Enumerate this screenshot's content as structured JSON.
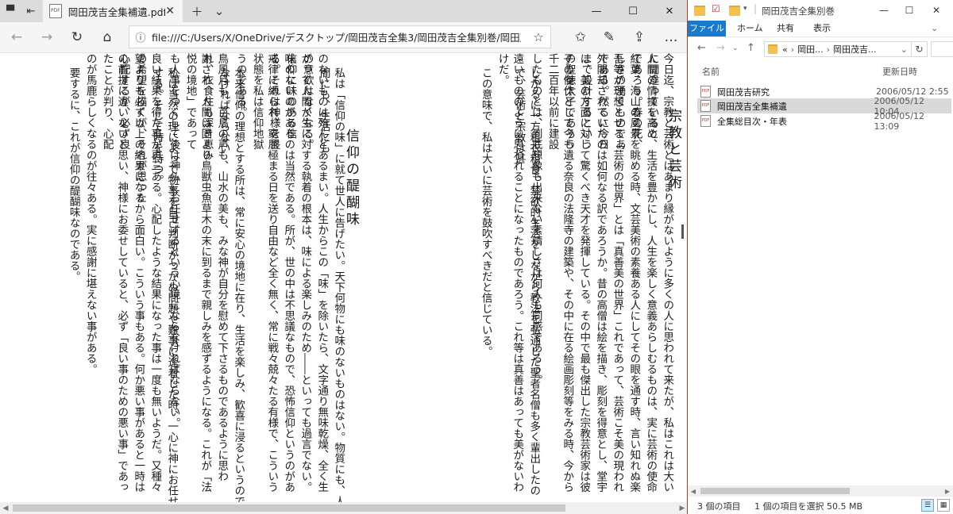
{
  "browser": {
    "tab_title": "岡田茂吉全集補遺.pdf",
    "tab_icon_text": "PDF",
    "url": "file:///C:/Users/X/OneDrive/デスクトップ/岡田茂吉全集3/岡田茂吉全集別巻/岡田茂吉全集補遺",
    "icons": [
      "tab-actions-icon",
      "back-tabs-icon",
      "close-icon",
      "new-tab-icon",
      "chevron-down-icon",
      "minimize-icon",
      "maximize-icon",
      "close-window-icon",
      "back-icon",
      "forward-icon",
      "refresh-icon",
      "home-icon",
      "info-icon",
      "favorite-star-icon",
      "favorites-icon",
      "pen-icon",
      "share-icon",
      "more-icon"
    ]
  },
  "document": {
    "essay1": {
      "title": "宗教と芸術",
      "columns": [
        "今日迄、宗教と芸術とはあまり縁がないように多くの人に思われて来たが、私はこれは大いに間違っていると",
        "人間の情操を高め、生活を豊かにし、人生を楽しく意義あらしむるものは、実に芸術の使命であろう。春の花、",
        "紅葉、海山の風景を眺める時、文芸美術の素養ある人にしてその眼を通す時、言い知れぬ楽しさの湧くものであ",
        "吾等が理想とせる「芸術の世界」とは「真善美の世界」これであって、芸術こそ美の現われである。然るに今日",
        "外閣却されていたのは如何なる訳であろうか。昔の高僧は絵を描き、彫刻を得意とし、堂宇まで設計するという",
        "に、美の方面に対して驚くべき天才を発揮している。その中で最も傑出した宗教芸術家は彼の聖徳太子であろう",
        "子の傑作として今も遺る奈良の法隆寺の建築や、その中に在る絵画彫刻等をみる時、今から千二百年以前に建設",
        "したものとは、到底想像も出来ない素晴しさは何人も同感であろう。",
        "しかるに一方粗衣粗食、禁欲的生活をしながら教法を弘通した聖者名僧も多く輩出したので、芸術と宗教は甚",
        "遠いもののように思われることになったものであろう。これ等は真善はあっても美がないわけだ。",
        "この意味で、私は大いに芸術を鼓吹すべきだと信じている。"
      ]
    },
    "essay2": {
      "title": "信仰の醍醐味",
      "columns": [
        "私は「信仰の味」に就て世人に告げたい。天下何物にも味のないものはない。物質にも、人間にも、生活にも",
        "のないものは殆んどあるまい。人生からこの「味」を除いたら、文字通り無味乾燥、全く生の意欲はなくなる。",
        "がって人間が生に対する執着の根本は、味による楽しみのため――といっても過言でない。信仰に味のある信",
        "味のないのがあるのは当然である。所が、世の中は不思議なもので、恐怖信仰というのがある。それは神様を畏",
        "戒律に縛られ、窮屈極まる日を送り自由など全く無く、常に戦々兢々たる有様で、こういう状態を私は信仰地獄",
        "うのである。",
        "本来信仰の理想とする所は、常に安心の境地に在り、生活を楽しみ、歓喜に浸るというのでなければならない",
        "鳥風月も、百鳥の声も、山水の美も、みな神が自分を慰めて下さるものであるように思われ、衣食住も深き恵み",
        "謝され、人間は固より鳥獣虫魚草木の末に到るまで親しみを感ずるようになる。これが「法悦の境地」であって",
        "も人事をつくして後は神仏にお任せするという心境にならなければならない。",
        "私は当然の理によって物事を自己判断がつかぬ問題や難事に逢着した時、一心に神にお任せする。そして時を待つ。",
        "良い結果を得た事が再三ある。心配したような結果になった事は一度も無いようだ。又種々の希望を描くが、それが思った",
        "望よりも必ず以上の結果になるから面白い。こういう事もある。何か悪い事があると一時は心配するが、必ず良",
        "の前提に違いないと思い、神様にお委せしていると、必ず「良い事のための悪い事」であったことが判り、心配",
        "のが馬鹿らしくなるのが往々ある。実に感謝に堪えない事がある。",
        "要するに、これが信仰の醍醐味なのである。"
      ]
    }
  },
  "explorer": {
    "window_title": "岡田茂吉全集別巻",
    "ribbon_tabs": [
      "ファイル",
      "ホーム",
      "共有",
      "表示"
    ],
    "breadcrumb": [
      "«",
      "岡田...",
      "岡田茂吉..."
    ],
    "columns": {
      "name": "名前",
      "date": "更新日時"
    },
    "files": [
      {
        "name": "岡田茂吉研究",
        "date": "2006/05/12 2:55",
        "selected": false
      },
      {
        "name": "岡田茂吉全集補遺",
        "date": "2006/05/12 10:04",
        "selected": true
      },
      {
        "name": "全集総目次・年表",
        "date": "2006/05/12 13:09",
        "selected": false
      }
    ],
    "status": {
      "count": "3 個の項目",
      "selection": "1 個の項目を選択 50.5 MB"
    }
  },
  "colors": {
    "accent": "#1979ca",
    "selection": "#d9d9d9",
    "window_border": "#c0392b"
  }
}
